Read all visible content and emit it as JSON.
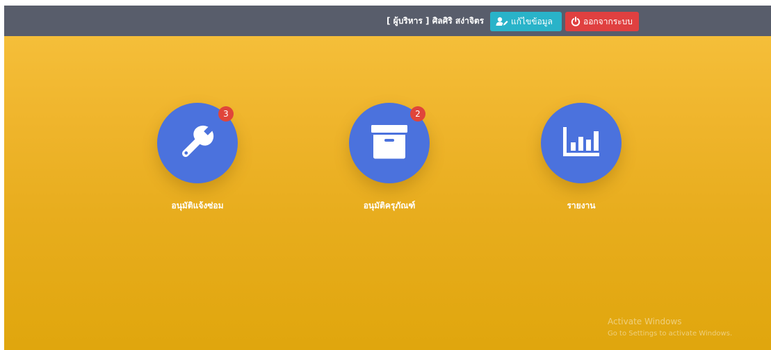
{
  "header": {
    "user_label": "[ ผู้บริหาร ] ศิลศิริ สง่าจิตร",
    "edit_button": {
      "label": "แก้ไขข้อมูล",
      "icon": "user-edit-icon",
      "color": "#29b3c9"
    },
    "logout_button": {
      "label": "ออกจากระบบ",
      "icon": "power-icon",
      "color": "#e04040"
    }
  },
  "menu": [
    {
      "label": "อนุมัติแจ้งซ่อม",
      "icon": "wrench-icon",
      "badge": "3"
    },
    {
      "label": "อนุมัติครุภัณฑ์",
      "icon": "archive-box-icon",
      "badge": "2"
    },
    {
      "label": "รายงาน",
      "icon": "bar-chart-icon"
    }
  ],
  "watermark": {
    "title": "Activate Windows",
    "subtitle": "Go to Settings to activate Windows."
  },
  "colors": {
    "topbar": "#585d6b",
    "tile": "#4b72dd",
    "badge": "#e0453a",
    "background_top": "#f7c23e",
    "background_bottom": "#e0a60d"
  }
}
